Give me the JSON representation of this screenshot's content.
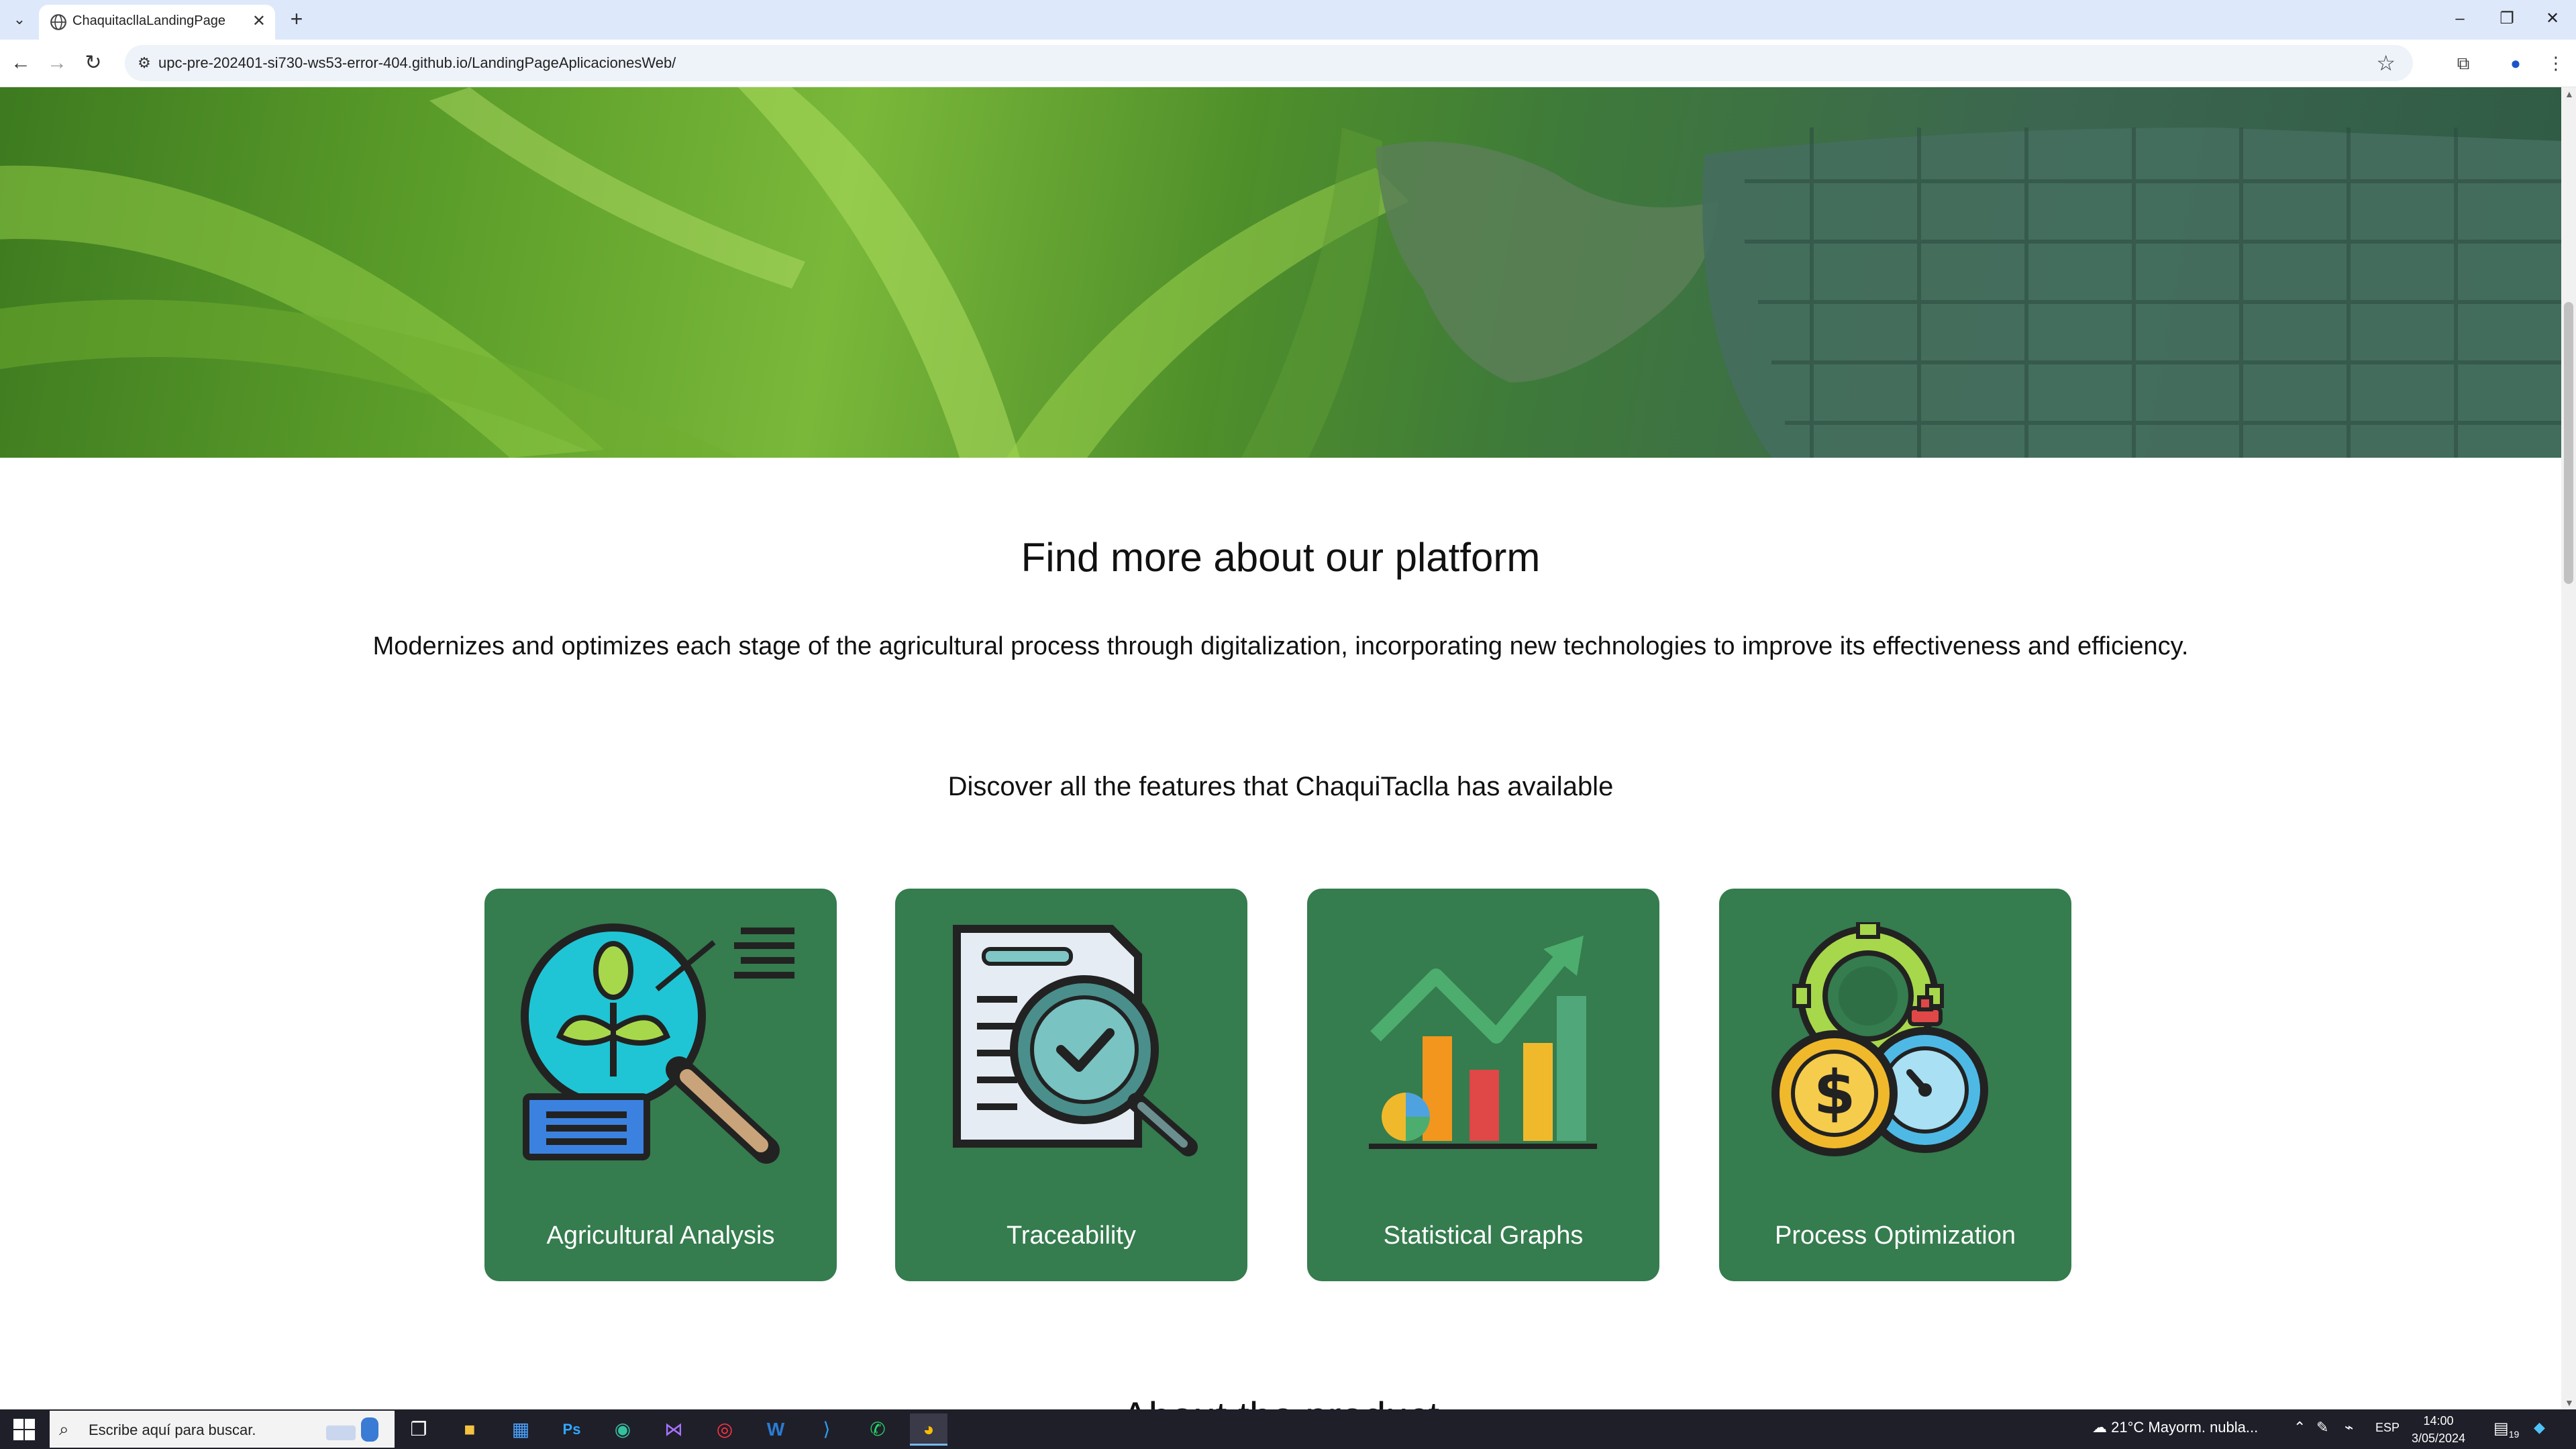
{
  "browser": {
    "tab_title": "ChaquitacllaLandingPage",
    "url": "upc-pre-202401-si730-ws53-error-404.github.io/LandingPageAplicacionesWeb/",
    "new_tab_symbol": "+",
    "tab_close_symbol": "✕"
  },
  "page": {
    "section_title": "Find more about our platform",
    "section_description": "Modernizes and optimizes each stage of the agricultural process through digitalization, incorporating new technologies to improve its effectiveness and efficiency.",
    "features_title": "Discover all the features that ChaquiTaclla has available",
    "features": [
      {
        "label": "Agricultural Analysis",
        "icon": "agricultural-analysis-icon"
      },
      {
        "label": "Traceability",
        "icon": "traceability-icon"
      },
      {
        "label": "Statistical Graphs",
        "icon": "statistical-graphs-icon"
      },
      {
        "label": "Process Optimization",
        "icon": "process-optimization-icon"
      }
    ],
    "next_section_title": "About the product",
    "card_color": "#357c4e"
  },
  "taskbar": {
    "search_placeholder": "Escribe aquí para buscar.",
    "weather": "21°C  Mayorm. nubla...",
    "language": "ESP",
    "time": "14:00",
    "date": "3/05/2024",
    "notifications": "19"
  }
}
